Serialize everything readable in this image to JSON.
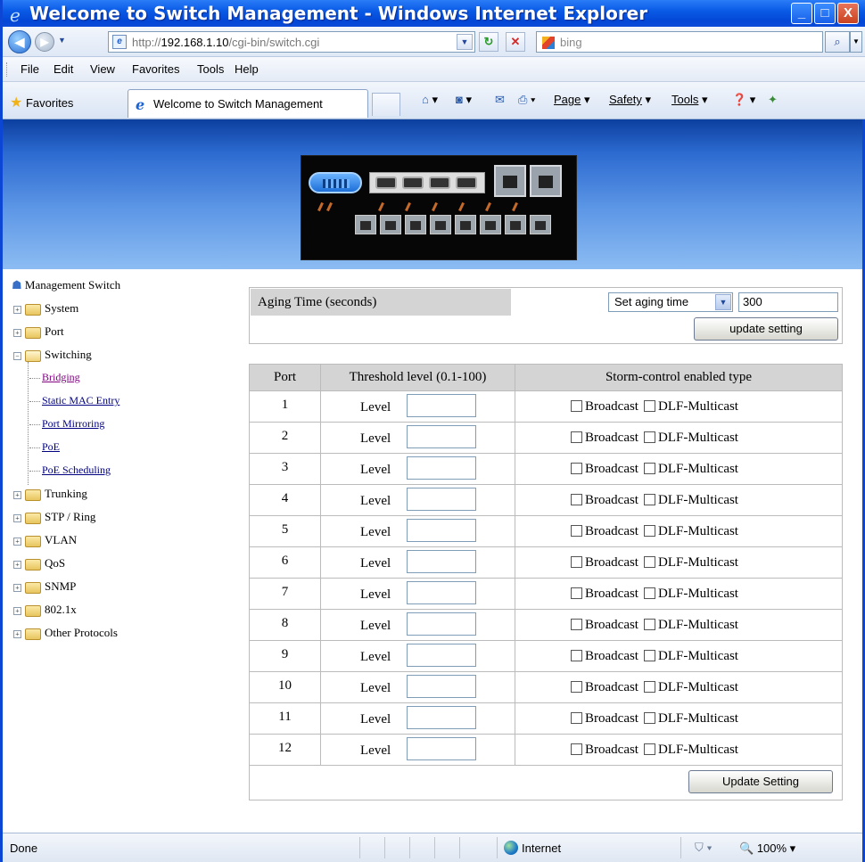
{
  "window": {
    "title": "Welcome to Switch Management - Windows Internet Explorer",
    "min": "_",
    "max": "□",
    "close": "X"
  },
  "address": {
    "url_prefix": "http://",
    "url_host": "192.168.1.10",
    "url_path": "/cgi-bin/switch.cgi",
    "search_placeholder": "bing"
  },
  "menu": {
    "file": "File",
    "edit": "Edit",
    "view": "View",
    "favorites": "Favorites",
    "tools": "Tools",
    "help": "Help"
  },
  "favbar": {
    "favorites": "Favorites",
    "tab_title": "Welcome to Switch Management",
    "page": "Page",
    "safety": "Safety",
    "tools": "Tools"
  },
  "sidebar": {
    "root": "Management Switch",
    "items": [
      {
        "label": "System"
      },
      {
        "label": "Port"
      },
      {
        "label": "Switching"
      },
      {
        "label": "Trunking"
      },
      {
        "label": "STP / Ring"
      },
      {
        "label": "VLAN"
      },
      {
        "label": "QoS"
      },
      {
        "label": "SNMP"
      },
      {
        "label": "802.1x"
      },
      {
        "label": "Other Protocols"
      }
    ],
    "switching_children": [
      {
        "label": "Bridging"
      },
      {
        "label": "Static MAC Entry"
      },
      {
        "label": "Port Mirroring"
      },
      {
        "label": "PoE"
      },
      {
        "label": "PoE Scheduling"
      }
    ]
  },
  "aging": {
    "label": "Aging Time (seconds)",
    "select_value": "Set aging time",
    "value": "300",
    "update_button": "update setting"
  },
  "storm": {
    "headers": {
      "port": "Port",
      "threshold": "Threshold level (0.1-100)",
      "type": "Storm-control enabled type"
    },
    "level_label": "Level",
    "broadcast_label": "Broadcast",
    "dlf_label": "DLF-Multicast",
    "ports": [
      "1",
      "2",
      "3",
      "4",
      "5",
      "6",
      "7",
      "8",
      "9",
      "10",
      "11",
      "12"
    ],
    "update_button": "Update Setting"
  },
  "status": {
    "left": "Done",
    "zone": "Internet",
    "zoom": "100%"
  }
}
